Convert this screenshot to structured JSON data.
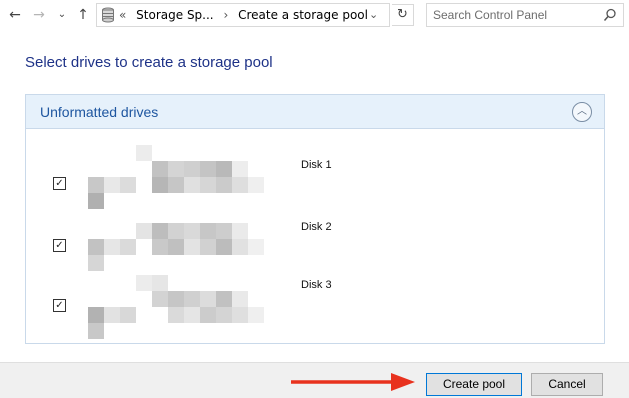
{
  "nav": {
    "back_icon": "←",
    "forward_icon": "→",
    "recent_icon": "⌄",
    "up_icon": "↑",
    "breadcrumb": [
      "«",
      "Storage Sp...",
      "›",
      "Create a storage pool"
    ],
    "dropdown_icon": "⌄",
    "refresh_icon": "↻",
    "search_placeholder": "Search Control Panel"
  },
  "page_title": "Select drives to create a storage pool",
  "group": {
    "title": "Unformatted drives",
    "collapse_icon": "︿",
    "drives": [
      {
        "label": "Disk 1",
        "checked": true,
        "check_mark": "✓"
      },
      {
        "label": "Disk 2",
        "checked": true,
        "check_mark": "✓"
      },
      {
        "label": "Disk 3",
        "checked": true,
        "check_mark": "✓"
      }
    ]
  },
  "footer": {
    "create_pool_label": "Create pool",
    "cancel_label": "Cancel"
  },
  "colors": {
    "title": "#1e3287",
    "group_header_bg": "#e6f1fb",
    "arrow": "#e8321e",
    "primary_border": "#0078d7"
  }
}
